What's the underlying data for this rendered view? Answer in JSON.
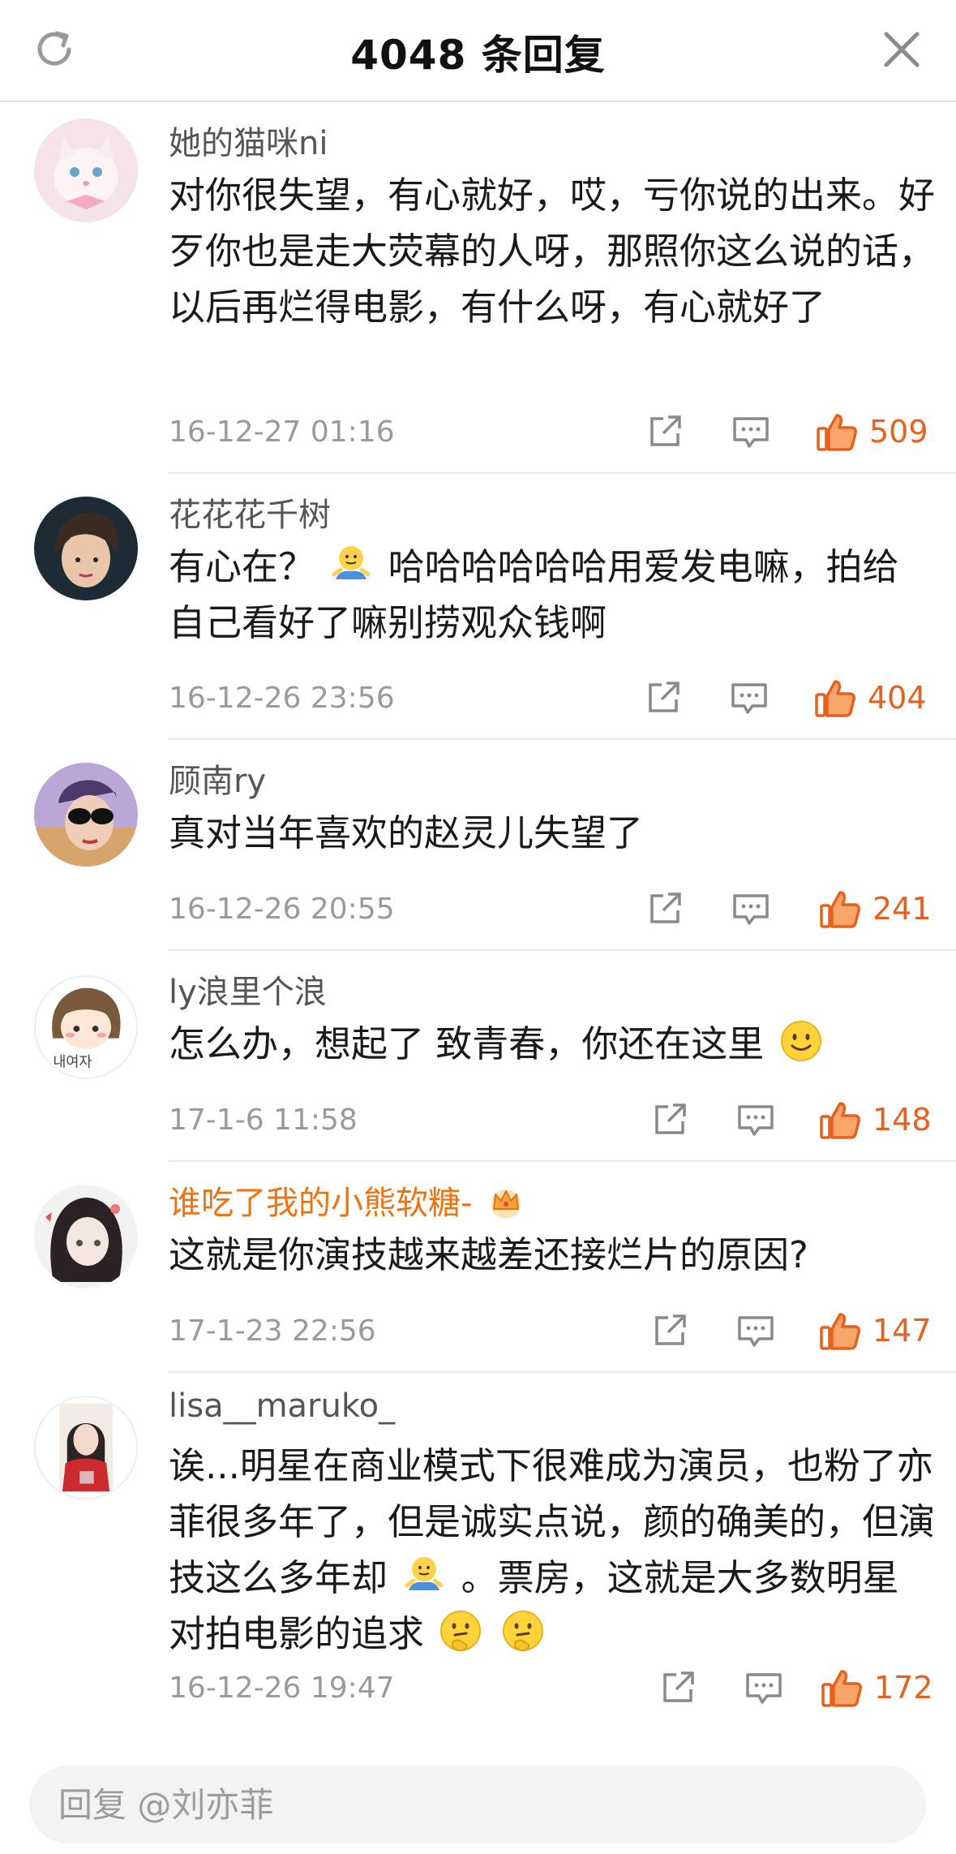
{
  "header": {
    "title": "4048 条回复"
  },
  "comments": [
    {
      "name": "她的猫咪ni",
      "text": "对你很失望，有心就好，哎，亏你说的出来。好歹你也是走大荧幕的人呀，那照你这么说的话，以后再烂得电影，有什么呀，有心就好了",
      "time": "16-12-27 01:16",
      "likes": "509"
    },
    {
      "name": "花花花千树",
      "text_a": "有心在？",
      "text_b": "哈哈哈哈哈哈用爱发电嘛，拍给自己看好了嘛别捞观众钱啊",
      "time": "16-12-26 23:56",
      "likes": "404"
    },
    {
      "name": "顾南ry",
      "text": "真对当年喜欢的赵灵儿失望了",
      "time": "16-12-26 20:55",
      "likes": "241"
    },
    {
      "name": "ly浪里个浪",
      "text": "怎么办，想起了 致青春，你还在这里",
      "time": "17-1-6 11:58",
      "likes": "148",
      "avatar_text": "내여자"
    },
    {
      "name": "谁吃了我的小熊软糖-",
      "text": "这就是你演技越来越差还接烂片的原因?",
      "time": "17-1-23 22:56",
      "likes": "147"
    },
    {
      "name": "lisa__maruko_",
      "text_a": "诶...明星在商业模式下很难成为演员，也粉了亦菲很多年了，但是诚实点说，颜的确美的，但演技这么多年却",
      "text_b": "。票房，这就是大多数明星对拍电影的追求",
      "time": "16-12-26 19:47",
      "likes": "172"
    }
  ],
  "footer": {
    "reply_placeholder": "回复 @刘亦菲"
  },
  "colors": {
    "like": "#e8601c",
    "vip_name": "#f0720f",
    "meta": "#9a9a9a"
  },
  "icons": [
    "refresh-icon",
    "close-icon",
    "share-icon",
    "comment-icon",
    "thumbs-up-icon",
    "shrug-emoji",
    "smile-emoji",
    "thinking-emoji",
    "crown-icon"
  ]
}
